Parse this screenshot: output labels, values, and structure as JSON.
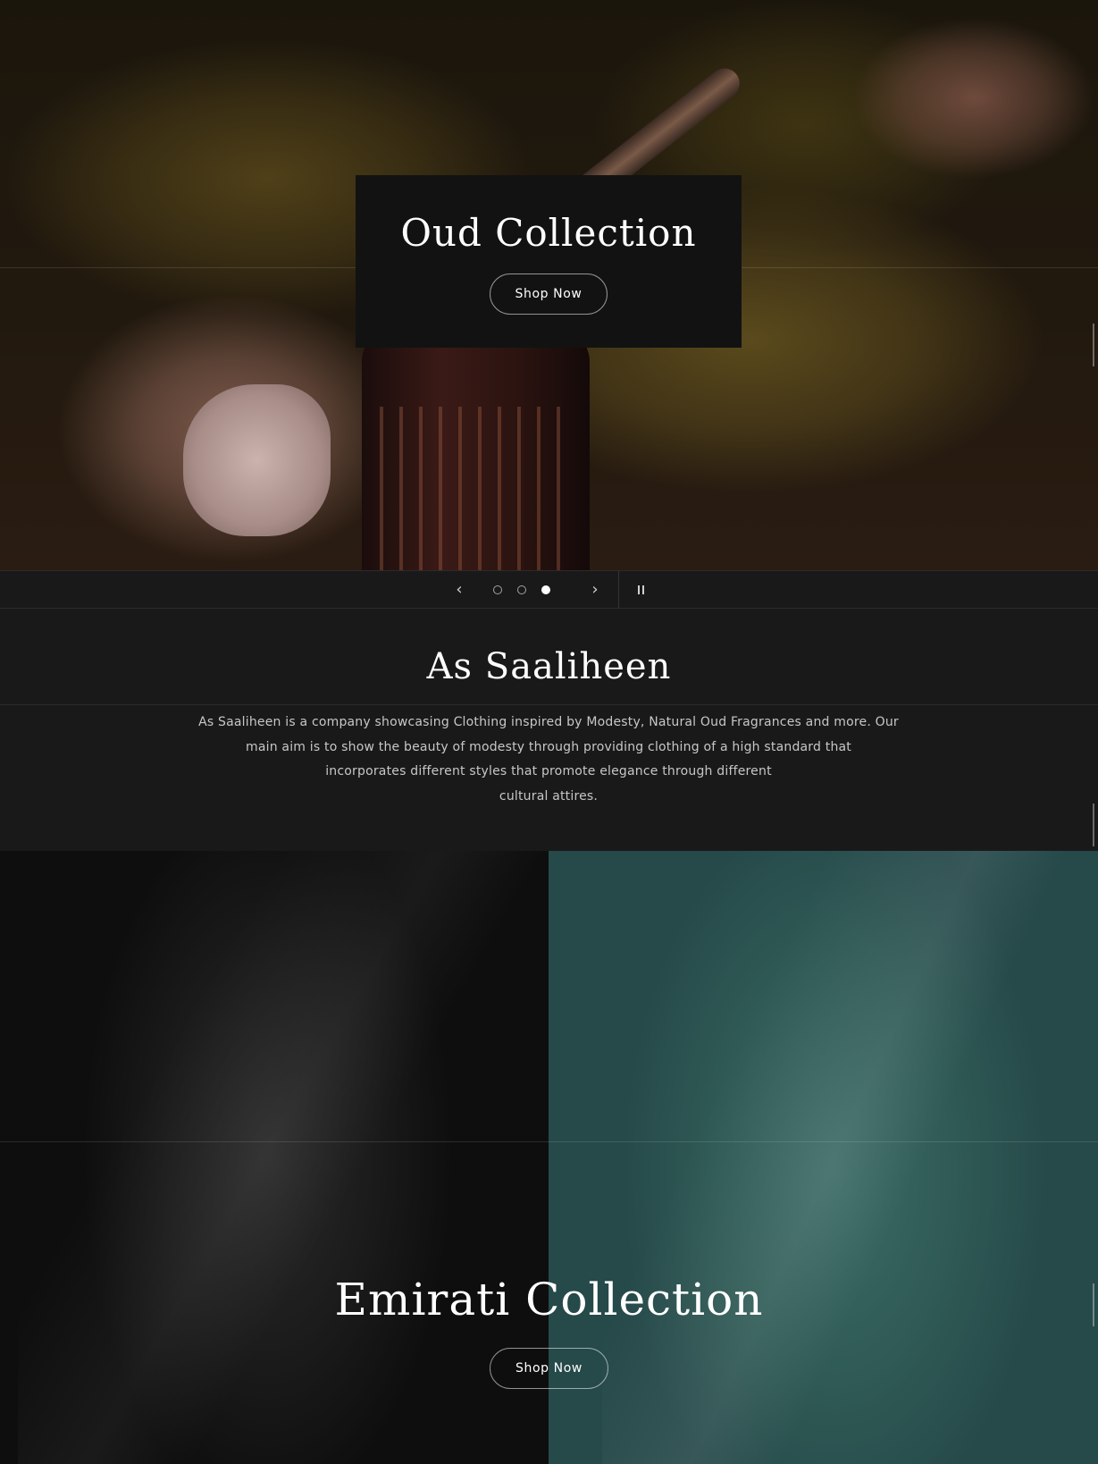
{
  "hero": {
    "title": "Oud Collection",
    "button_label": "Shop Now"
  },
  "slider": {
    "slide_count": 3,
    "active_slide": 3,
    "prev_icon": "chevron-left-icon",
    "next_icon": "chevron-right-icon",
    "pause_icon": "pause-icon"
  },
  "about": {
    "title": "As Saaliheen",
    "lines": [
      "As Saaliheen is a company showcasing Clothing inspired by Modesty, Natural Oud Fragrances and more. Our",
      "main aim is to show the beauty of modesty through providing clothing of a high standard that",
      "incorporates different styles that promote elegance through different",
      "cultural attires."
    ]
  },
  "collection": {
    "title": "Emirati Collection",
    "button_label": "Shop Now"
  },
  "colors": {
    "page_background": "#1a1919",
    "hero_box": "#121212",
    "teal_panel": "#2f5a55",
    "text_primary": "#ffffff",
    "text_body": "#c7c7c7"
  }
}
